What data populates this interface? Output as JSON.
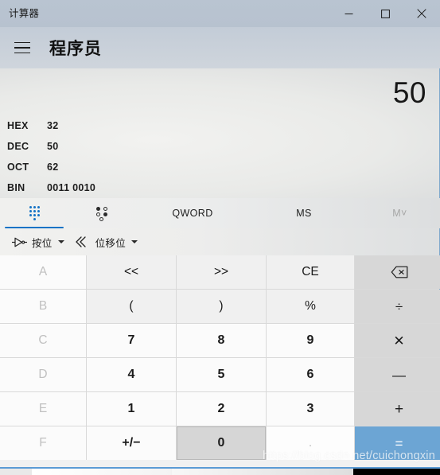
{
  "window": {
    "title": "计算器",
    "controls": [
      {
        "name": "minimize",
        "glyph": "minimize-icon"
      },
      {
        "name": "maximize",
        "glyph": "maximize-icon"
      },
      {
        "name": "close",
        "glyph": "close-icon"
      }
    ]
  },
  "header": {
    "menu_icon": "hamburger-icon",
    "mode_title": "程序员"
  },
  "display": {
    "value": "50",
    "radix": [
      {
        "label": "HEX",
        "value": "32"
      },
      {
        "label": "DEC",
        "value": "50"
      },
      {
        "label": "OCT",
        "value": "62"
      },
      {
        "label": "BIN",
        "value": "0011 0010"
      }
    ]
  },
  "tabs": [
    {
      "name": "keypad",
      "label": "",
      "icon": "keypad-dots-icon",
      "selected": true
    },
    {
      "name": "bit-toggle",
      "label": "",
      "icon": "bit-toggle-icon",
      "selected": false
    },
    {
      "name": "word-size",
      "label": "QWORD",
      "icon": "",
      "selected": false
    },
    {
      "name": "memory-store",
      "label": "MS",
      "icon": "",
      "selected": false
    },
    {
      "name": "memory-menu",
      "label": "M˅",
      "icon": "",
      "selected": false,
      "disabled": true
    }
  ],
  "options": [
    {
      "name": "bitwise",
      "label": "按位",
      "icon": "logic-gate-icon"
    },
    {
      "name": "bit-shift",
      "label": "位移位",
      "icon": "double-chevron-icon"
    }
  ],
  "keypad": {
    "rows": [
      [
        {
          "name": "hex-a",
          "label": "A",
          "kind": "hex"
        },
        {
          "name": "shift-left",
          "label": "<<",
          "kind": "fn"
        },
        {
          "name": "shift-right",
          "label": ">>",
          "kind": "fn"
        },
        {
          "name": "clear-entry",
          "label": "CE",
          "kind": "fn"
        },
        {
          "name": "backspace",
          "label": "",
          "kind": "op",
          "icon": "backspace-icon"
        }
      ],
      [
        {
          "name": "hex-b",
          "label": "B",
          "kind": "hex"
        },
        {
          "name": "paren-open",
          "label": "(",
          "kind": "fn"
        },
        {
          "name": "paren-close",
          "label": ")",
          "kind": "fn"
        },
        {
          "name": "modulo",
          "label": "%",
          "kind": "fn"
        },
        {
          "name": "divide",
          "label": "÷",
          "kind": "op"
        }
      ],
      [
        {
          "name": "hex-c",
          "label": "C",
          "kind": "hex"
        },
        {
          "name": "digit-7",
          "label": "7",
          "kind": "num"
        },
        {
          "name": "digit-8",
          "label": "8",
          "kind": "num"
        },
        {
          "name": "digit-9",
          "label": "9",
          "kind": "num"
        },
        {
          "name": "multiply",
          "label": "✕",
          "kind": "op"
        }
      ],
      [
        {
          "name": "hex-d",
          "label": "D",
          "kind": "hex"
        },
        {
          "name": "digit-4",
          "label": "4",
          "kind": "num"
        },
        {
          "name": "digit-5",
          "label": "5",
          "kind": "num"
        },
        {
          "name": "digit-6",
          "label": "6",
          "kind": "num"
        },
        {
          "name": "subtract",
          "label": "—",
          "kind": "op"
        }
      ],
      [
        {
          "name": "hex-e",
          "label": "E",
          "kind": "hex"
        },
        {
          "name": "digit-1",
          "label": "1",
          "kind": "num"
        },
        {
          "name": "digit-2",
          "label": "2",
          "kind": "num"
        },
        {
          "name": "digit-3",
          "label": "3",
          "kind": "num"
        },
        {
          "name": "add",
          "label": "+",
          "kind": "op"
        }
      ],
      [
        {
          "name": "hex-f",
          "label": "F",
          "kind": "hex"
        },
        {
          "name": "negate",
          "label": "+/−",
          "kind": "num"
        },
        {
          "name": "digit-0",
          "label": "0",
          "kind": "num",
          "hovered": true
        },
        {
          "name": "decimal-point",
          "label": ".",
          "kind": "hex"
        },
        {
          "name": "equals",
          "label": "=",
          "kind": "equals"
        }
      ]
    ]
  },
  "watermark": "https://blog.csdn.net/cuichongxin",
  "colors": {
    "titlebar": "#b7c2cf",
    "accent": "#1573c6",
    "equals": "#6ca5d4",
    "operator_key": "#d7d7d7",
    "number_key": "#fbfbfb",
    "function_key": "#f0f0f0",
    "disabled_text": "#c0c0c0"
  }
}
